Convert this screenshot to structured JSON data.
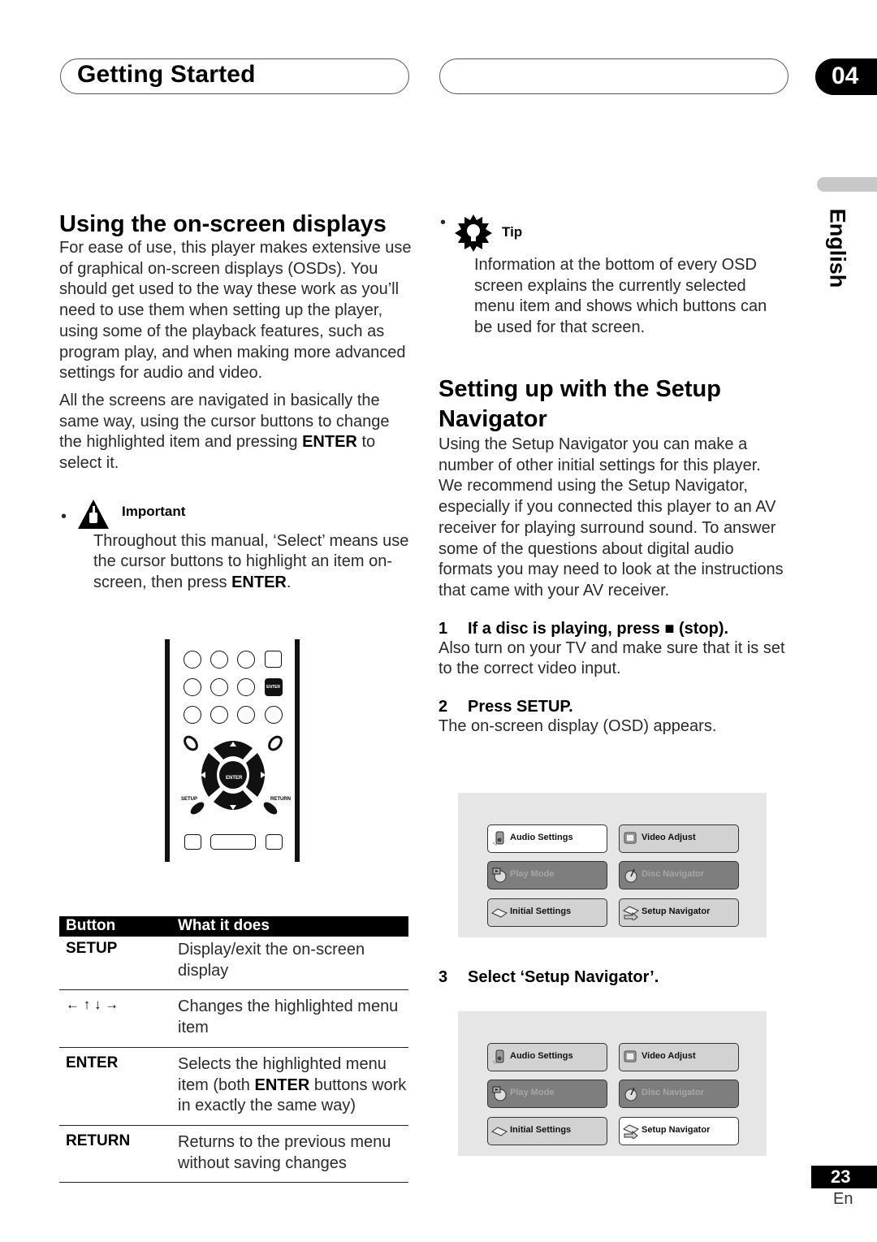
{
  "header": {
    "section_title": "Getting Started",
    "chapter_number": "04",
    "language_tab": "English"
  },
  "left": {
    "heading": "Using the on-screen displays",
    "para1": "For ease of use, this player makes extensive use of graphical on-screen displays (OSDs). You should get used to the way these work as you’ll need to use them when setting up the player, using some of the playback features, such as program play, and when making more advanced settings for audio and video.",
    "para2_prefix": "All the screens are navigated in basically the same way, using the cursor buttons to change the highlighted item and pressing ",
    "para2_bold": "ENTER",
    "para2_suffix": " to select it.",
    "important": {
      "icon": "important-hand-icon",
      "label": "Important",
      "bullet_prefix": "Throughout this manual, ‘Select’ means use the cursor buttons to highlight an item on-screen, then press ",
      "bullet_bold": "ENTER",
      "bullet_suffix": "."
    },
    "remote": {
      "enter_small": "ENTER",
      "enter_center": "ENTER",
      "setup": "SETUP",
      "return": "RETURN"
    },
    "table": {
      "headers": [
        "Button",
        "What it does"
      ],
      "rows": [
        {
          "button": "SETUP",
          "desc": "Display/exit the on-screen display"
        },
        {
          "button": "← ↑ ↓ →",
          "desc": "Changes the highlighted menu item"
        },
        {
          "button": "ENTER",
          "desc_prefix": "Selects the highlighted menu item (both ",
          "desc_bold": "ENTER",
          "desc_suffix": " buttons work in exactly the same way)"
        },
        {
          "button": "RETURN",
          "desc": "Returns to the previous menu without saving changes"
        }
      ]
    }
  },
  "right": {
    "tip": {
      "icon": "tip-lightbulb-icon",
      "label": "Tip",
      "bullet": "Information at the bottom of every OSD screen explains the currently selected menu item and shows which buttons can be used for that screen."
    },
    "heading": "Setting up with the Setup Navigator",
    "para": "Using the Setup Navigator you can make a number of other initial settings for this player. We recommend using the Setup Navigator, especially if you connected this player to an AV receiver for playing surround sound. To answer some of the questions about digital audio formats you may need to look at the instructions that came with your AV receiver.",
    "steps": [
      {
        "num": "1",
        "title": "If a disc is playing, press ■ (stop).",
        "body": "Also turn on your TV and make sure that it is set to the correct video input."
      },
      {
        "num": "2",
        "title": "Press SETUP.",
        "body": "The on-screen display (OSD) appears."
      },
      {
        "num": "3",
        "title": "Select ‘Setup Navigator’."
      }
    ],
    "osd1": {
      "items": [
        {
          "label": "Audio Settings",
          "icon": "speaker-icon",
          "state": "highlighted"
        },
        {
          "label": "Video Adjust",
          "icon": "tv-icon",
          "state": "normal"
        },
        {
          "label": "Play Mode",
          "icon": "disc-play-icon",
          "state": "disabled"
        },
        {
          "label": "Disc Navigator",
          "icon": "disc-navigator-icon",
          "state": "disabled"
        },
        {
          "label": "Initial Settings",
          "icon": "initial-settings-icon",
          "state": "normal"
        },
        {
          "label": "Setup Navigator",
          "icon": "setup-navigator-icon",
          "state": "normal"
        }
      ]
    },
    "osd2": {
      "items": [
        {
          "label": "Audio Settings",
          "icon": "speaker-icon",
          "state": "normal"
        },
        {
          "label": "Video Adjust",
          "icon": "tv-icon",
          "state": "normal"
        },
        {
          "label": "Play Mode",
          "icon": "disc-play-icon",
          "state": "disabled"
        },
        {
          "label": "Disc Navigator",
          "icon": "disc-navigator-icon",
          "state": "disabled"
        },
        {
          "label": "Initial Settings",
          "icon": "initial-settings-icon",
          "state": "normal"
        },
        {
          "label": "Setup Navigator",
          "icon": "setup-navigator-icon",
          "state": "highlighted"
        }
      ]
    }
  },
  "footer": {
    "page_number": "23",
    "page_lang": "En"
  }
}
